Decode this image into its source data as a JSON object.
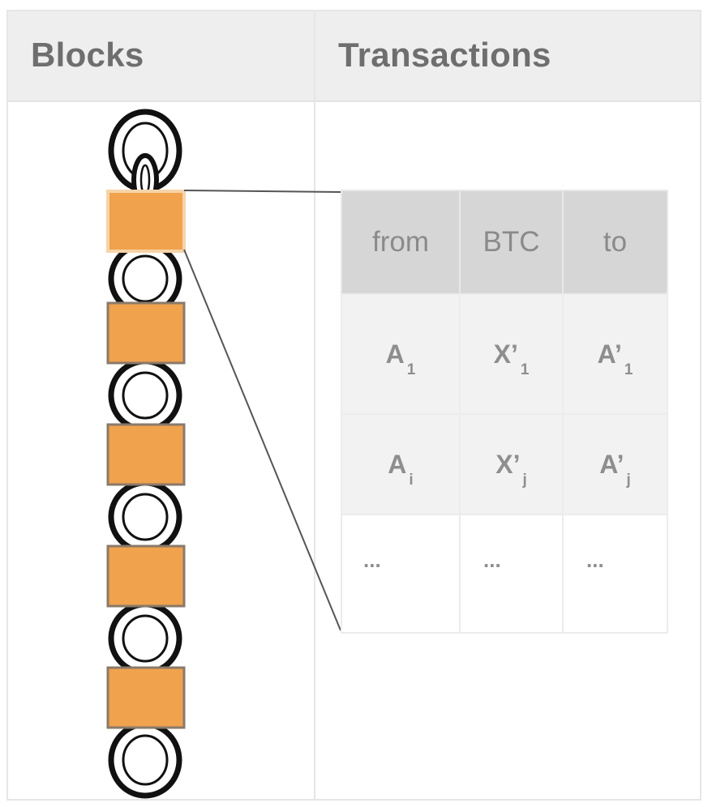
{
  "header": {
    "blocks": "Blocks",
    "transactions": "Transactions"
  },
  "table": {
    "columns": [
      "from",
      "BTC",
      "to"
    ],
    "rows": [
      [
        {
          "base": "A",
          "sub": "1"
        },
        {
          "base": "X’",
          "sub": "1"
        },
        {
          "base": "A’",
          "sub": "1"
        }
      ],
      [
        {
          "base": "A",
          "sub": "i"
        },
        {
          "base": "X’",
          "sub": "j"
        },
        {
          "base": "A’",
          "sub": "j"
        }
      ]
    ],
    "continuation": [
      "...",
      "...",
      "..."
    ]
  },
  "blocks": {
    "count": 5,
    "color": "#f0a24d",
    "highlight_index": 0
  },
  "colors": {
    "header_bg": "#eeeeee",
    "table_head_bg": "#d6d6d6",
    "table_body_bg": "#f2f2f2",
    "text": "#6e6e6e"
  }
}
